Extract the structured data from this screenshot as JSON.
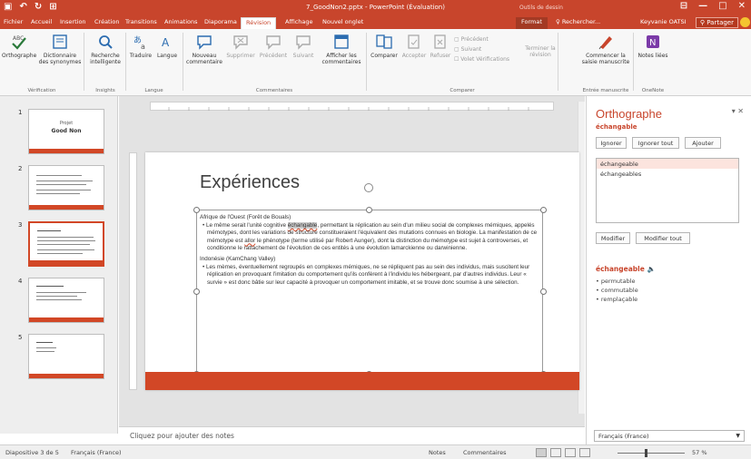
{
  "titlebar": {
    "title": "7_GoodNon2.pptx - PowerPoint (Évaluation)",
    "context_label": "Outils de dessin",
    "qat_save": "▣",
    "qat_undo": "↶",
    "qat_redo": "↻",
    "qat_extra": "⊞",
    "win_min": "—",
    "win_max": "□",
    "win_close": "✕",
    "ribbon_toggle": "⊟"
  },
  "tabs": [
    "Fichier",
    "Accueil",
    "Insertion",
    "Création",
    "Transitions",
    "Animations",
    "Diaporama",
    "Révision",
    "Affichage",
    "Nouvel onglet",
    "Format"
  ],
  "tell_me": "♀ Rechercher...",
  "user": "Keyvanie OATSI",
  "share_label": "Partager",
  "ribbon": {
    "orthographe": "Orthographe",
    "dictionnaire": "Dictionnaire des synonymes",
    "group_verification": "Vérification",
    "recherche": "Recherche intelligente",
    "group_insights": "Insights",
    "traduire": "Traduire",
    "langue": "Langue",
    "group_langue": "Langue",
    "nouveau_commentaire": "Nouveau commentaire",
    "supprimer": "Supprimer",
    "precedent": "Précédent",
    "suivant": "Suivant",
    "afficher_commentaires": "Afficher les commentaires",
    "group_commentaires": "Commentaires",
    "comparer": "Comparer",
    "accepter": "Accepter",
    "refuser": "Refuser",
    "cmp_precedent": "Précédent",
    "cmp_suivant": "Suivant",
    "volet_verifications": "Volet Vérifications",
    "terminer": "Terminer la révision",
    "group_comparer": "Comparer",
    "commencer_saisie": "Commencer la saisie manuscrite",
    "group_manuscrite": "Entrée manuscrite",
    "notes_liees": "Notes liées",
    "group_onenote": "OneNote"
  },
  "thumbnails": [
    {
      "num": "1",
      "title": "Projet",
      "subtitle": "Good Non"
    },
    {
      "num": "2"
    },
    {
      "num": "3"
    },
    {
      "num": "4"
    },
    {
      "num": "5"
    }
  ],
  "slide": {
    "title": "Expériences",
    "section1_heading": "Afrique de l'Ouest (Forêt de Bouals)",
    "section1_pre": "Le même serait l'unité cognitive ",
    "section1_flag": "échangable",
    "section1_mid": ", permettant la réplication au sein d'un milieu social de complexes mémiques, appelés mémotypes, dont les variations de structure constitueraient l'équivalent des mutations connues en biologie. La manifestation de ce mémotype est ",
    "section1_flag2": "allor",
    "section1_post": " le phénotype (terme utilisé par Robert Aunger), dont la distinction du mémotype est sujet à controverses, et conditionne le rattachement de l'évolution de ces entités à une évolution lamarckienne ou darwinienne.",
    "section2_heading": "Indonésie (KamChang Valley)",
    "section2_text": "Les mèmes, éventuellement regroupés en complexes mémiques, ne se répliquent pas au sein des individus, mais suscitent leur réplication en provoquant l'imitation du comportement qu'ils confèrent à l'individu les hébergeant, par d'autres individus. Leur « survie » est donc bâtie sur leur capacité à provoquer un comportement imitable, et se trouve donc soumise à une sélection."
  },
  "notes_placeholder": "Cliquez pour ajouter des notes",
  "spell_pane": {
    "title": "Orthographe",
    "word": "échangable",
    "btn_ignorer": "Ignorer",
    "btn_ignorer_tout": "Ignorer tout",
    "btn_ajouter": "Ajouter",
    "suggestions": [
      "échangeable",
      "échangeables"
    ],
    "btn_modifier": "Modifier",
    "btn_modifier_tout": "Modifier tout",
    "def_word": "échangeable",
    "synonyms": [
      "• permutable",
      "• commutable",
      "• remplaçable"
    ],
    "language": "Français (France)",
    "close": "▾ ✕"
  },
  "status": {
    "slide_info": "Diapositive 3 de 5",
    "language": "Français (France)",
    "notes": "Notes",
    "comments": "Commentaires",
    "zoom": "57 %"
  },
  "colors": {
    "accent": "#c8452c",
    "slide_bar": "#d24726"
  }
}
